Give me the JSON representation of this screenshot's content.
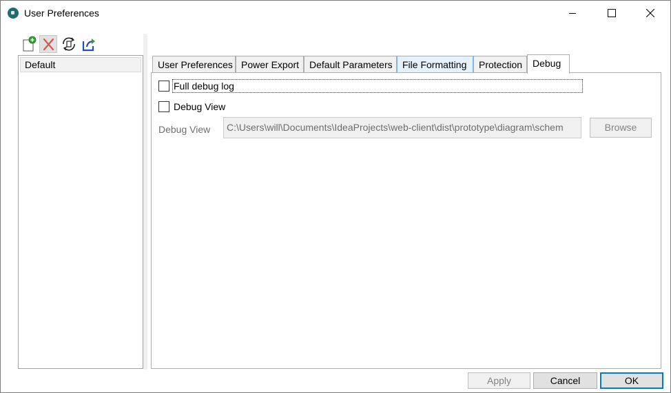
{
  "window": {
    "title": "User Preferences",
    "controls": {
      "minimize": "minimize-icon",
      "maximize": "maximize-icon",
      "close": "close-icon"
    }
  },
  "toolbar": {
    "buttons": [
      {
        "icon": "new-document-icon"
      },
      {
        "icon": "delete-icon"
      },
      {
        "icon": "refresh-icon"
      },
      {
        "icon": "export-icon"
      }
    ]
  },
  "tree": {
    "items": [
      {
        "label": "Default"
      }
    ]
  },
  "tabs": [
    {
      "label": "User Preferences"
    },
    {
      "label": "Power Export"
    },
    {
      "label": "Default Parameters"
    },
    {
      "label": "File Formatting"
    },
    {
      "label": "Protection"
    },
    {
      "label": "Debug"
    }
  ],
  "debug": {
    "full_debug_log_label": "Full debug log",
    "debug_view_label": "Debug View",
    "path_label": "Debug View",
    "path_value": "C:\\Users\\will\\Documents\\IdeaProjects\\web-client\\dist\\prototype\\diagram\\schem",
    "browse_label": "Browse"
  },
  "footer": {
    "apply_label": "Apply",
    "cancel_label": "Cancel",
    "ok_label": "OK"
  },
  "colors": {
    "accent": "#0078d7",
    "tab_highlight": "#e5f1fb",
    "app_icon": "#1e6e6a"
  }
}
